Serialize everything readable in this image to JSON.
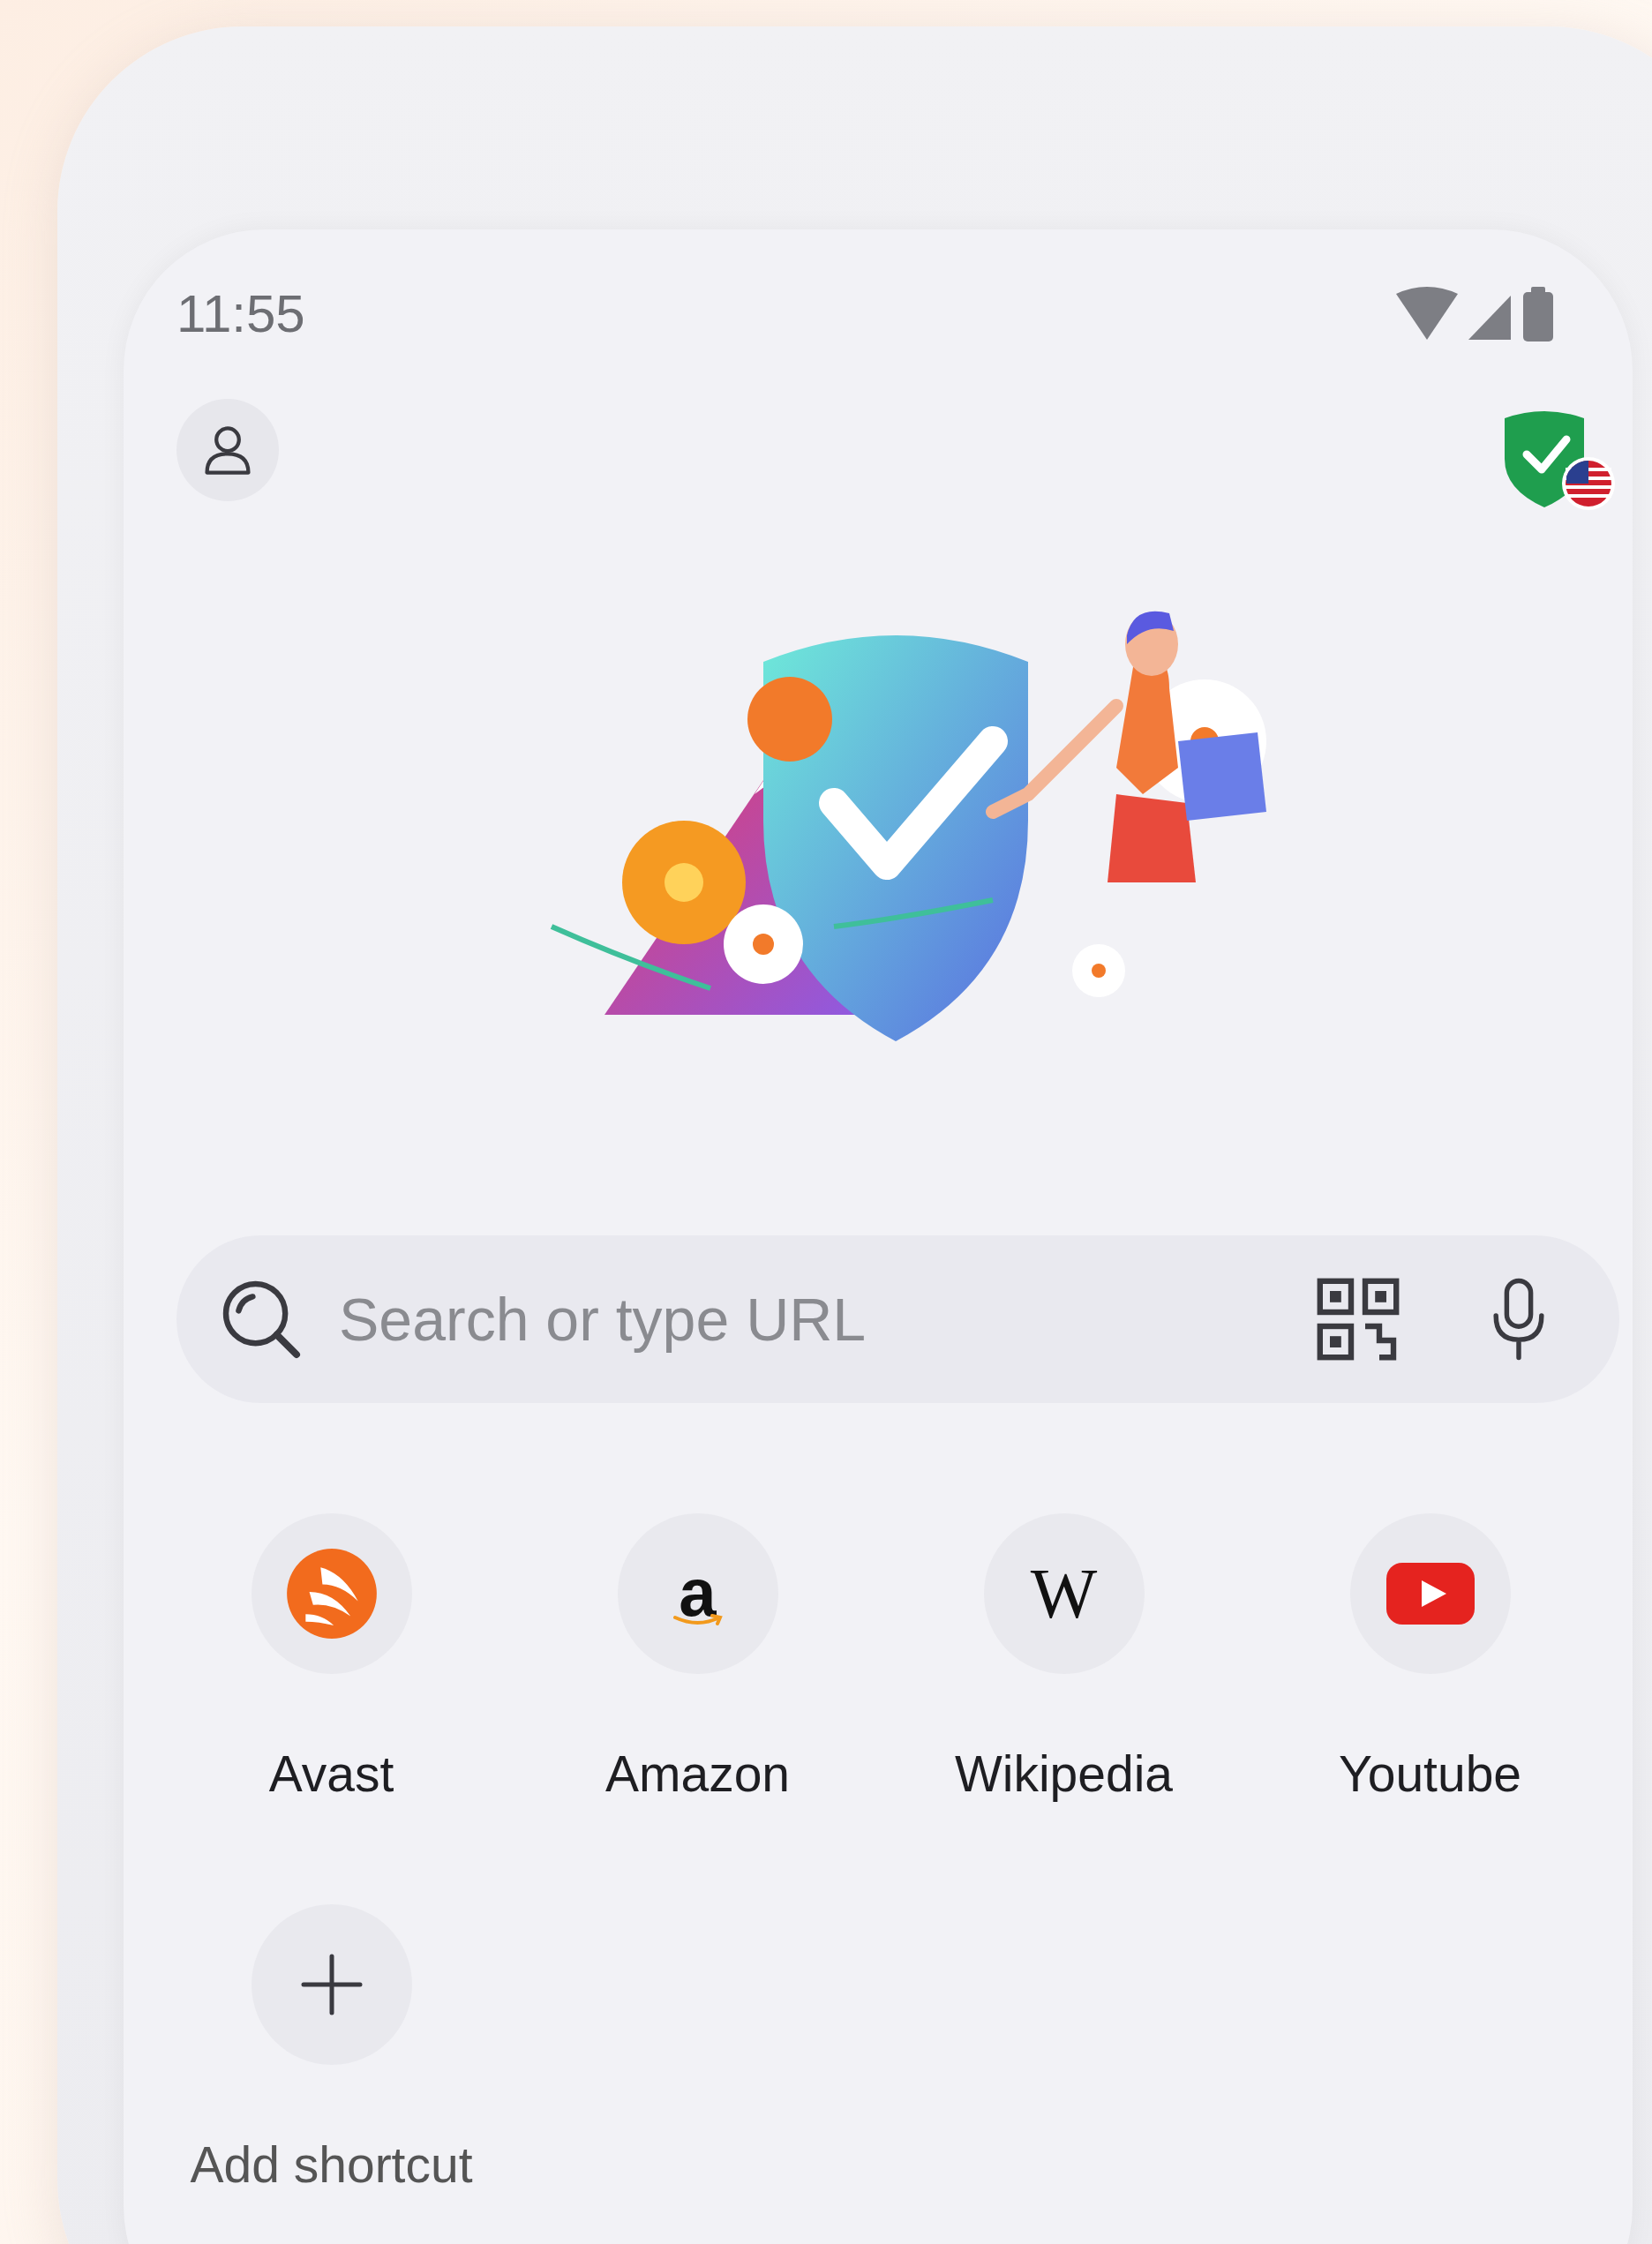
{
  "status_bar": {
    "time": "11:55"
  },
  "search": {
    "placeholder": "Search or type URL"
  },
  "shortcuts": [
    {
      "label": "Avast",
      "kind": "avast"
    },
    {
      "label": "Amazon",
      "kind": "amazon",
      "glyph": "a"
    },
    {
      "label": "Wikipedia",
      "kind": "wikipedia",
      "glyph": "W"
    },
    {
      "label": "Youtube",
      "kind": "youtube"
    }
  ],
  "add_shortcut": {
    "label": "Add shortcut"
  }
}
